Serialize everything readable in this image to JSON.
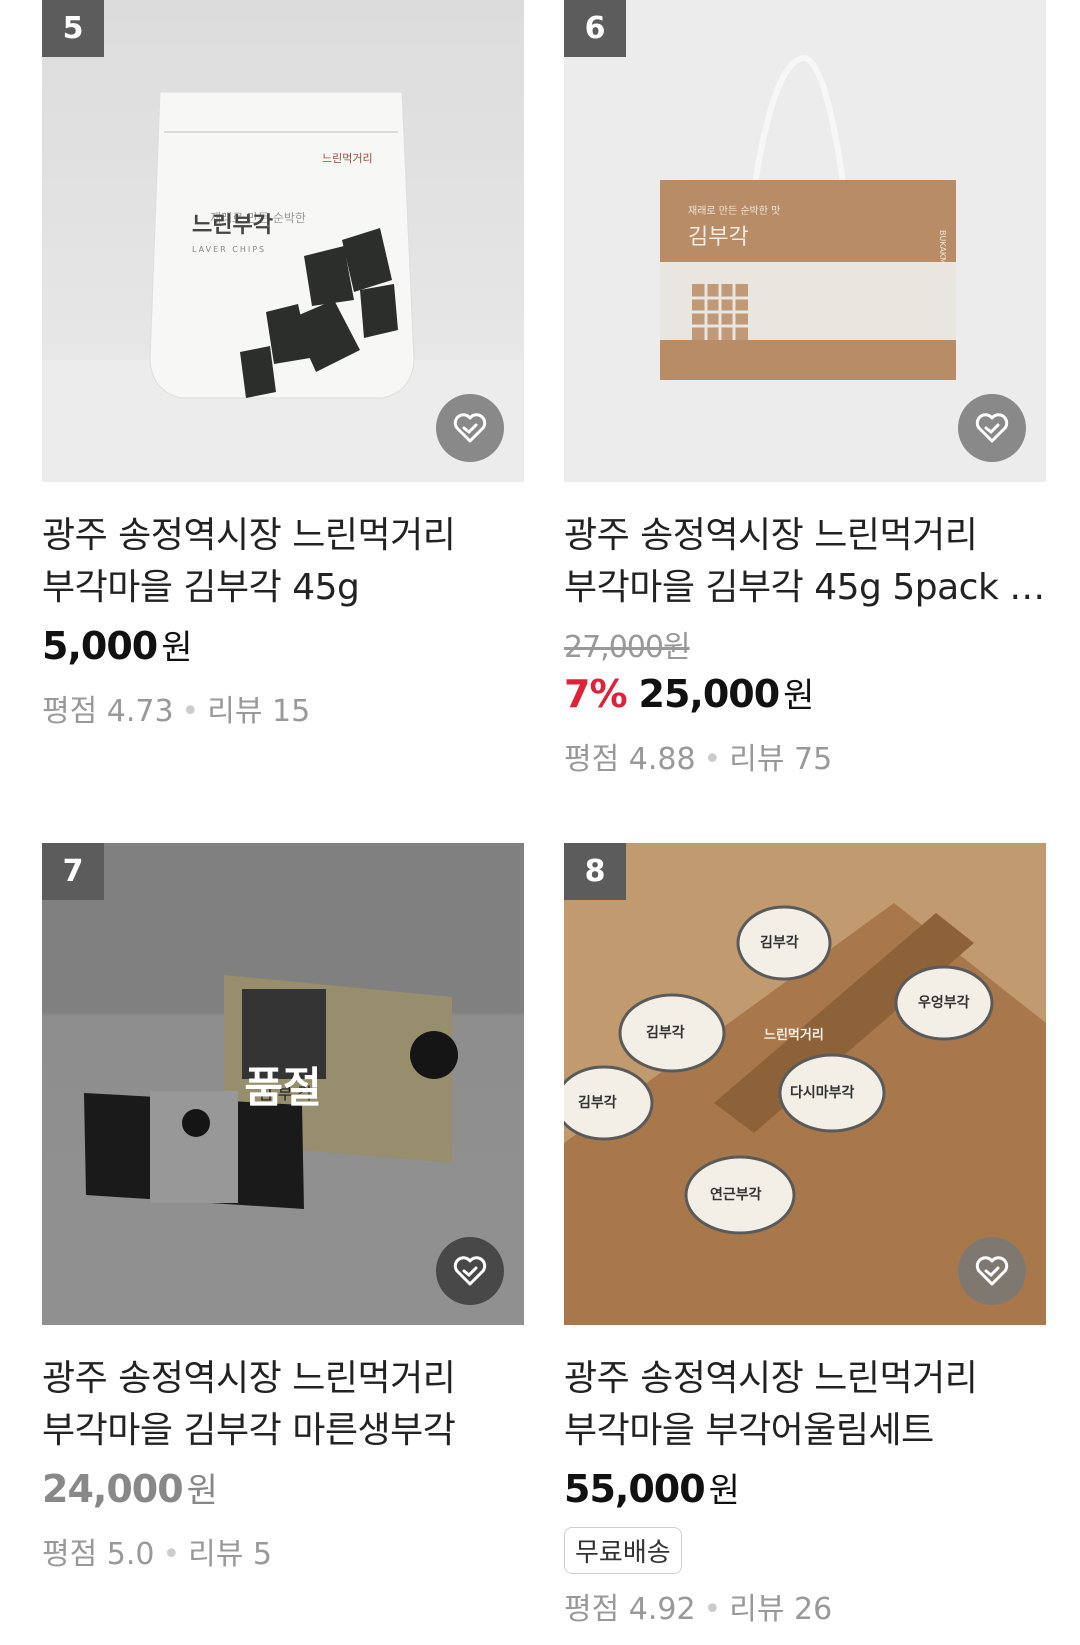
{
  "products": [
    {
      "rank": "5",
      "title_line1": "광주 송정역시장 느린먹거리",
      "title_line2": "부각마을 김부각 45g",
      "price": "5,000",
      "currency": "원",
      "rating_label": "평점 4.73",
      "review_label": "리뷰 15",
      "pkg_brand": "느린먹거리",
      "pkg_sub": "재래로 만든 순박한",
      "pkg_name": "느린부각",
      "pkg_en": "LAVER CHIPS"
    },
    {
      "rank": "6",
      "title_line1": "광주 송정역시장 느린먹거리",
      "title_line2": "부각마을 김부각 45g 5pack 세트",
      "original_price": "27,000원",
      "discount": "7%",
      "price": "25,000",
      "currency": "원",
      "rating_label": "평점 4.88",
      "review_label": "리뷰 75",
      "pkg_sub": "재래로 만든 순박한 맛",
      "pkg_name": "김부각",
      "pkg_en": "BUKAKMAEUL"
    },
    {
      "rank": "7",
      "title_line1": "광주 송정역시장 느린먹거리",
      "title_line2": "부각마을 김부각 마른생부각",
      "price": "24,000",
      "currency": "원",
      "rating_label": "평점 5.0",
      "review_label": "리뷰 5",
      "soldout": "품절",
      "pkg_name": "김 부 각"
    },
    {
      "rank": "8",
      "title_line1": "광주 송정역시장 느린먹거리",
      "title_line2": "부각마을 부각어울림세트",
      "price": "55,000",
      "currency": "원",
      "badge": "무료배송",
      "rating_label": "평점 4.92",
      "review_label": "리뷰 26",
      "pkg_brand": "느린먹거리",
      "jar_labels": [
        "김부각",
        "김부각",
        "다시마부각",
        "우엉부각",
        "연근부각",
        "김부각"
      ]
    }
  ],
  "colors": {
    "discount": "#e0213a",
    "rank_bg": "#5c5c5c"
  },
  "icons": {
    "wishlist": "heart-check-icon"
  }
}
